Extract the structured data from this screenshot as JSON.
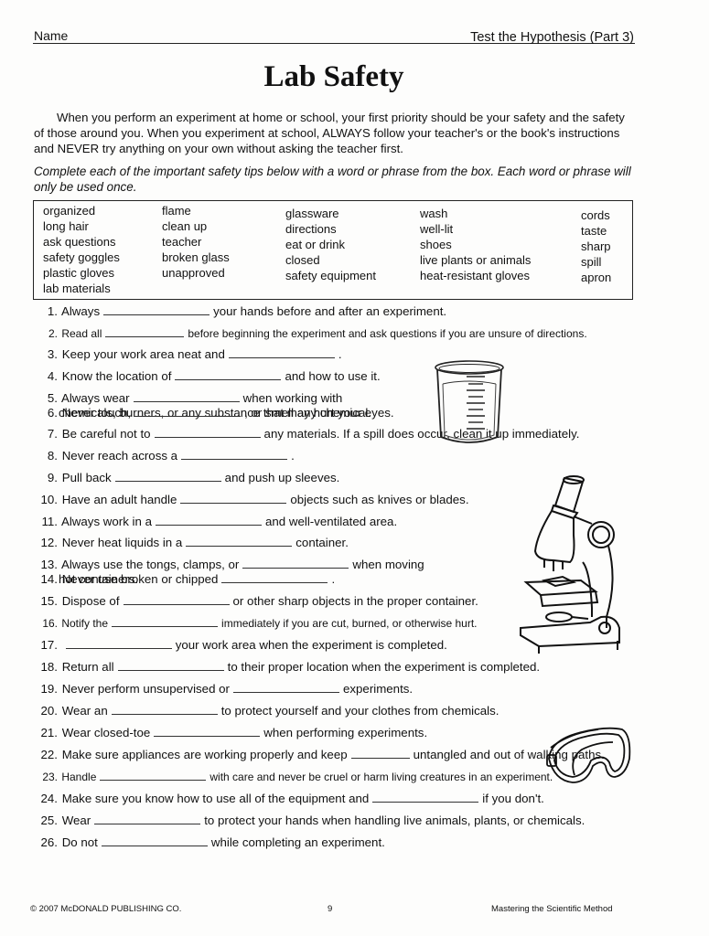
{
  "header": {
    "name_label": "Name",
    "unit_label": "Test the Hypothesis (Part 3)"
  },
  "title": "Lab Safety",
  "intro": "When you perform an experiment at home or school, your first priority should be your safety and the safety of those around you.  When you experiment at school, ALWAYS follow your teacher's or the book's instructions and NEVER try anything on your own without asking the teacher first.",
  "instructions": "Complete each of the important safety tips below with a word or phrase from the box.  Each word or phrase will only be used once.",
  "word_box": {
    "columns": [
      [
        "organized",
        "long hair",
        "ask questions",
        "safety goggles",
        "plastic gloves",
        "lab materials"
      ],
      [
        "flame",
        "clean up",
        "teacher",
        "broken glass",
        "unapproved"
      ],
      [
        "glassware",
        "directions",
        "eat or drink",
        "closed",
        "safety equipment"
      ],
      [
        "wash",
        "well-lit",
        "shoes",
        "live plants or animals",
        "heat-resistant gloves"
      ],
      [
        "cords",
        "taste",
        "sharp",
        "spill",
        "apron"
      ]
    ]
  },
  "questions": [
    {
      "num": "1.",
      "before": "Always",
      "after": "your hands before and after an experiment.",
      "answer": ""
    },
    {
      "num": "2.",
      "before": "Read all",
      "after": "before beginning the experiment and ask questions if you are unsure of directions.",
      "answer": ""
    },
    {
      "num": "3.",
      "before": "Keep your work area neat and",
      "after": ".",
      "answer": ""
    },
    {
      "num": "4.",
      "before": "Know the location of",
      "after": "and how to use it.",
      "answer": ""
    },
    {
      "num": "5.",
      "before": "Always wear",
      "after": "when working with",
      "cont": "chemicals, burners, or any substance that may hurt your eyes.",
      "answer": ""
    },
    {
      "num": "6.",
      "before": "Never touch,",
      "after": ", or smell any chemical.",
      "answer": ""
    },
    {
      "num": "7.",
      "before": "Be careful not to",
      "after": "any materials.  If a spill does occur, clean it up immediately.",
      "answer": ""
    },
    {
      "num": "8.",
      "before": "Never reach across a",
      "after": ".",
      "answer": ""
    },
    {
      "num": "9.",
      "before": "Pull back",
      "after": "and push up sleeves.",
      "answer": ""
    },
    {
      "num": "10.",
      "before": "Have an adult handle",
      "after": "objects such as knives or blades.",
      "answer": ""
    },
    {
      "num": "11.",
      "before": "Always work in a",
      "after": "and well-ventilated area.",
      "answer": ""
    },
    {
      "num": "12.",
      "before": "Never heat liquids in a",
      "after": "container.",
      "answer": ""
    },
    {
      "num": "13.",
      "before": "Always use the tongs, clamps, or",
      "after": "when moving",
      "cont": "hot containers.",
      "answer": ""
    },
    {
      "num": "14.",
      "before": "Never use broken or chipped",
      "after": ".",
      "answer": ""
    },
    {
      "num": "15.",
      "before": "Dispose of",
      "after": "or other sharp objects in the proper container.",
      "answer": ""
    },
    {
      "num": "16.",
      "before": "Notify the",
      "after": "immediately if you are cut, burned, or otherwise hurt.",
      "answer": ""
    },
    {
      "num": "17.",
      "before": "",
      "after": "your work area when the experiment is completed.",
      "answer": ""
    },
    {
      "num": "18.",
      "before": "Return all",
      "after": "to their proper location when the experiment is completed.",
      "answer": ""
    },
    {
      "num": "19.",
      "before": "Never perform unsupervised or",
      "after": "experiments.",
      "answer": ""
    },
    {
      "num": "20.",
      "before": "Wear an",
      "after": "to protect yourself and your clothes from chemicals.",
      "answer": ""
    },
    {
      "num": "21.",
      "before": "Wear closed-toe",
      "after": "when performing experiments.",
      "answer": ""
    },
    {
      "num": "22.",
      "before": "Make sure appliances are working properly and keep",
      "after": "untangled and out of walking paths.",
      "answer": ""
    },
    {
      "num": "23.",
      "before": "Handle",
      "after": "with care and never be cruel or harm living creatures in an experiment.",
      "answer": ""
    },
    {
      "num": "24.",
      "before": "Make sure you know how to use all of the equipment and",
      "after": "if you don't.",
      "answer": ""
    },
    {
      "num": "25.",
      "before": "Wear",
      "after": "to protect your hands when handling live animals, plants, or chemicals.",
      "answer": ""
    },
    {
      "num": "26.",
      "before": "Do not",
      "after": "while completing an experiment.",
      "answer": ""
    }
  ],
  "illustrations": [
    "beaker-icon",
    "microscope-icon",
    "safety-goggles-icon"
  ],
  "footer": {
    "copyright": "© 2007 McDONALD PUBLISHING CO.",
    "page_number": "9",
    "book_title": "Mastering the Scientific Method"
  }
}
